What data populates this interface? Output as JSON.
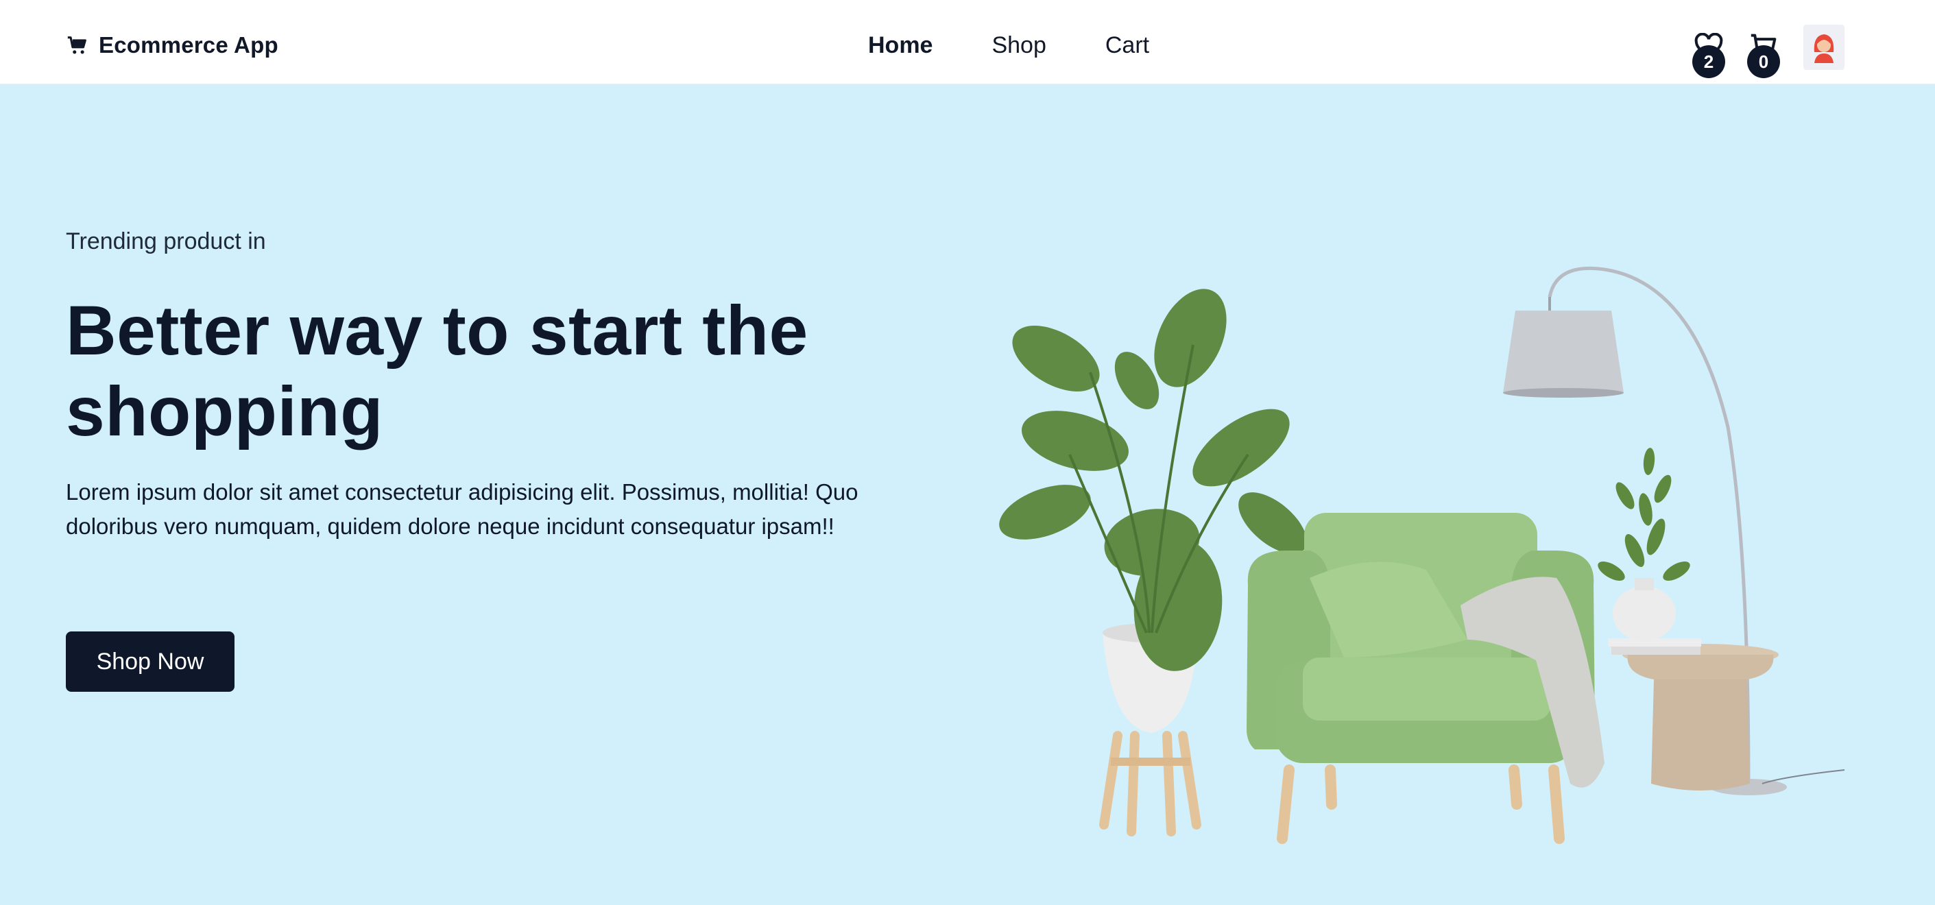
{
  "header": {
    "brand": "Ecommerce App",
    "nav": [
      {
        "label": "Home",
        "active": true
      },
      {
        "label": "Shop",
        "active": false
      },
      {
        "label": "Cart",
        "active": false
      }
    ],
    "wishlist_count": "2",
    "cart_count": "0",
    "icons": [
      "cart-icon",
      "heart-icon",
      "bag-icon",
      "avatar"
    ]
  },
  "hero": {
    "eyebrow": "Trending product in",
    "title": "Better way to start the shopping",
    "description": "Lorem ipsum dolor sit amet consectetur adipisicing elit. Possimus, mollitia! Quo doloribus vero numquam, quidem dolore neque incidunt consequatur ipsam!!",
    "cta": "Shop Now"
  },
  "colors": {
    "hero_background": "#d1f0fc",
    "primary_dark": "#0f172a",
    "chair_green": "#8fba7a"
  }
}
